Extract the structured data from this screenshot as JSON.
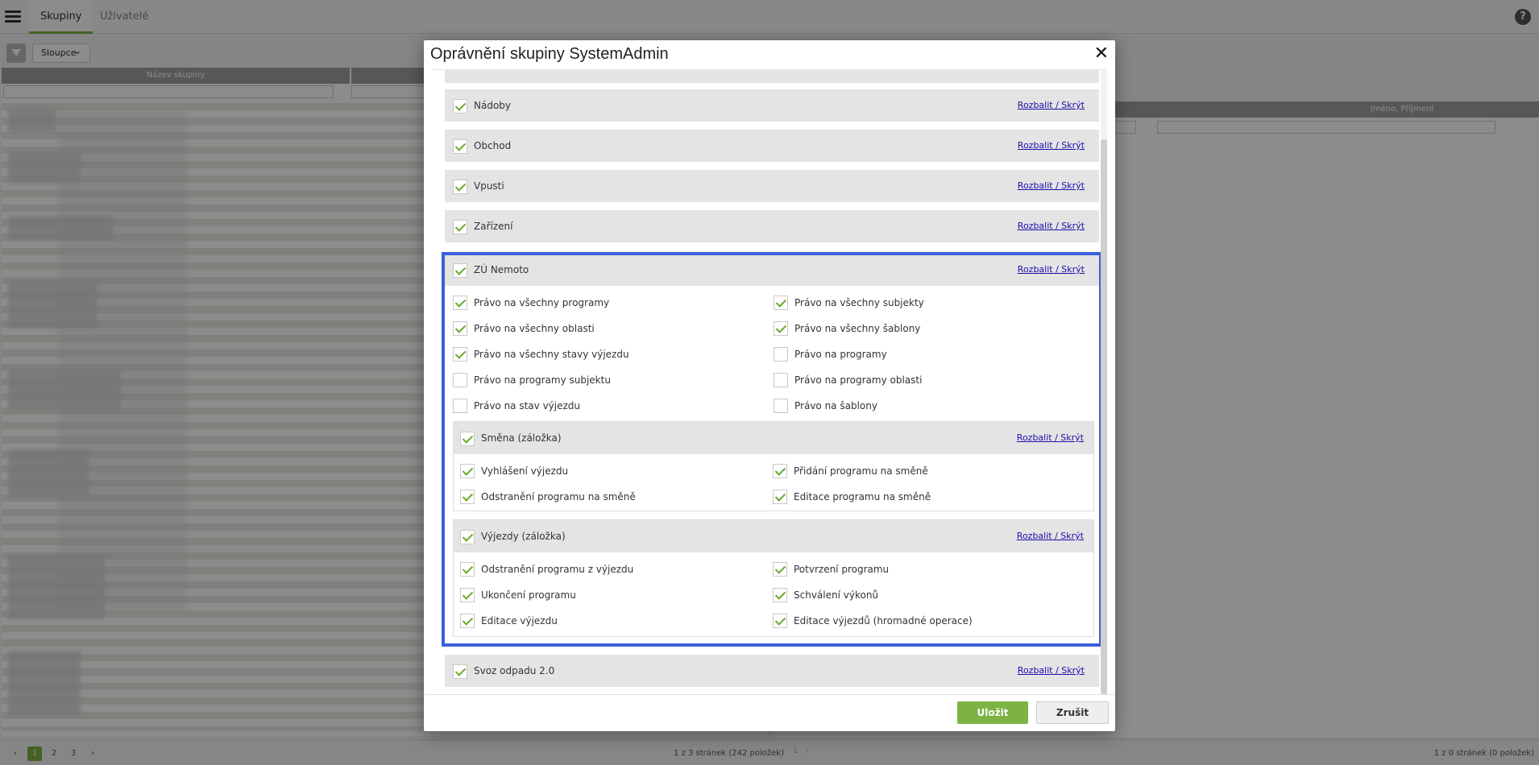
{
  "app": {
    "tabs": [
      {
        "label": "Skupiny"
      },
      {
        "label": "Uživatelé"
      }
    ],
    "help": "?",
    "columns_button": "Sloupce",
    "left_column_header": "Název skupiny",
    "right_column_header": "Jméno, Příjmení",
    "pager_left": {
      "pages": [
        "1",
        "2",
        "3"
      ],
      "info": "1 z 3 stránek (242 položek)"
    },
    "pager_right": {
      "pages": [
        "1"
      ],
      "info": "1 z 0 stránek (0 položek)"
    }
  },
  "modal": {
    "title": "Oprávnění skupiny SystemAdmin",
    "toggle_link": "Rozbalit / Skrýt",
    "sections": [
      {
        "label": "Nádoby",
        "checked": true
      },
      {
        "label": "Obchod",
        "checked": true
      },
      {
        "label": "Vpusti",
        "checked": true
      },
      {
        "label": "Zařízení",
        "checked": true
      },
      {
        "label": "ZÚ Nemoto",
        "checked": true
      },
      {
        "label": "Svoz odpadu 2.0",
        "checked": true
      }
    ],
    "zu_permissions": [
      {
        "label": "Právo na všechny programy",
        "checked": true
      },
      {
        "label": "Právo na všechny subjekty",
        "checked": true
      },
      {
        "label": "Právo na všechny oblasti",
        "checked": true
      },
      {
        "label": "Právo na všechny šablony",
        "checked": true
      },
      {
        "label": "Právo na všechny stavy výjezdu",
        "checked": true
      },
      {
        "label": "Právo na programy",
        "checked": false
      },
      {
        "label": "Právo na programy subjektu",
        "checked": false
      },
      {
        "label": "Právo na programy oblasti",
        "checked": false
      },
      {
        "label": "Právo na stav výjezdu",
        "checked": false
      },
      {
        "label": "Právo na šablony",
        "checked": false
      }
    ],
    "subsections": [
      {
        "label": "Směna (záložka)",
        "checked": true,
        "items": [
          {
            "label": "Vyhlášení výjezdu",
            "checked": true
          },
          {
            "label": "Přidání programu na směně",
            "checked": true
          },
          {
            "label": "Odstranění programu na směně",
            "checked": true
          },
          {
            "label": "Editace programu na směně",
            "checked": true
          }
        ]
      },
      {
        "label": "Výjezdy (záložka)",
        "checked": true,
        "items": [
          {
            "label": "Odstranění programu z výjezdu",
            "checked": true
          },
          {
            "label": "Potvrzení programu",
            "checked": true
          },
          {
            "label": "Ukončení programu",
            "checked": true
          },
          {
            "label": "Schválení výkonů",
            "checked": true
          },
          {
            "label": "Editace výjezdu",
            "checked": true
          },
          {
            "label": "Editace výjezdů (hromadné operace)",
            "checked": true
          }
        ]
      }
    ],
    "save_label": "Uložit",
    "cancel_label": "Zrušit"
  },
  "colors": {
    "accent": "#7cb342",
    "highlight_border": "#3b5fd9",
    "link": "#1a0dab"
  }
}
